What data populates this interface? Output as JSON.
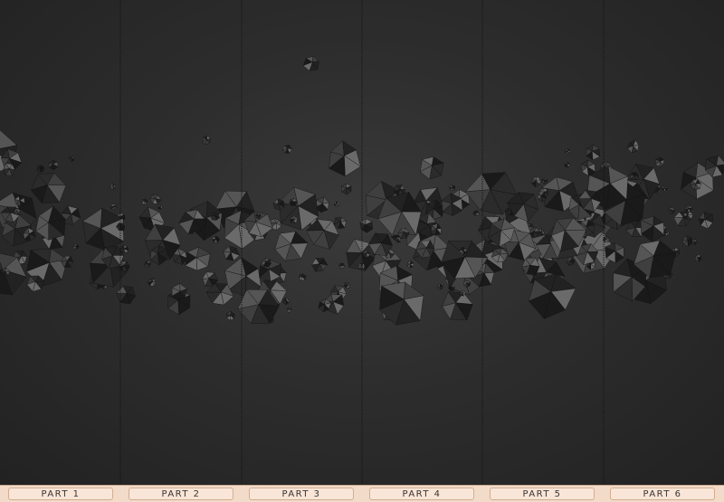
{
  "parts": [
    {
      "label": "PART 1"
    },
    {
      "label": "PART 2"
    },
    {
      "label": "PART 3"
    },
    {
      "label": "PART 4"
    },
    {
      "label": "PART 5"
    },
    {
      "label": "PART 6"
    }
  ],
  "colors": {
    "background": "#2d2d2d",
    "divider": "#141414",
    "footer": "#f3dbc9",
    "label_text": "#3a3330"
  }
}
